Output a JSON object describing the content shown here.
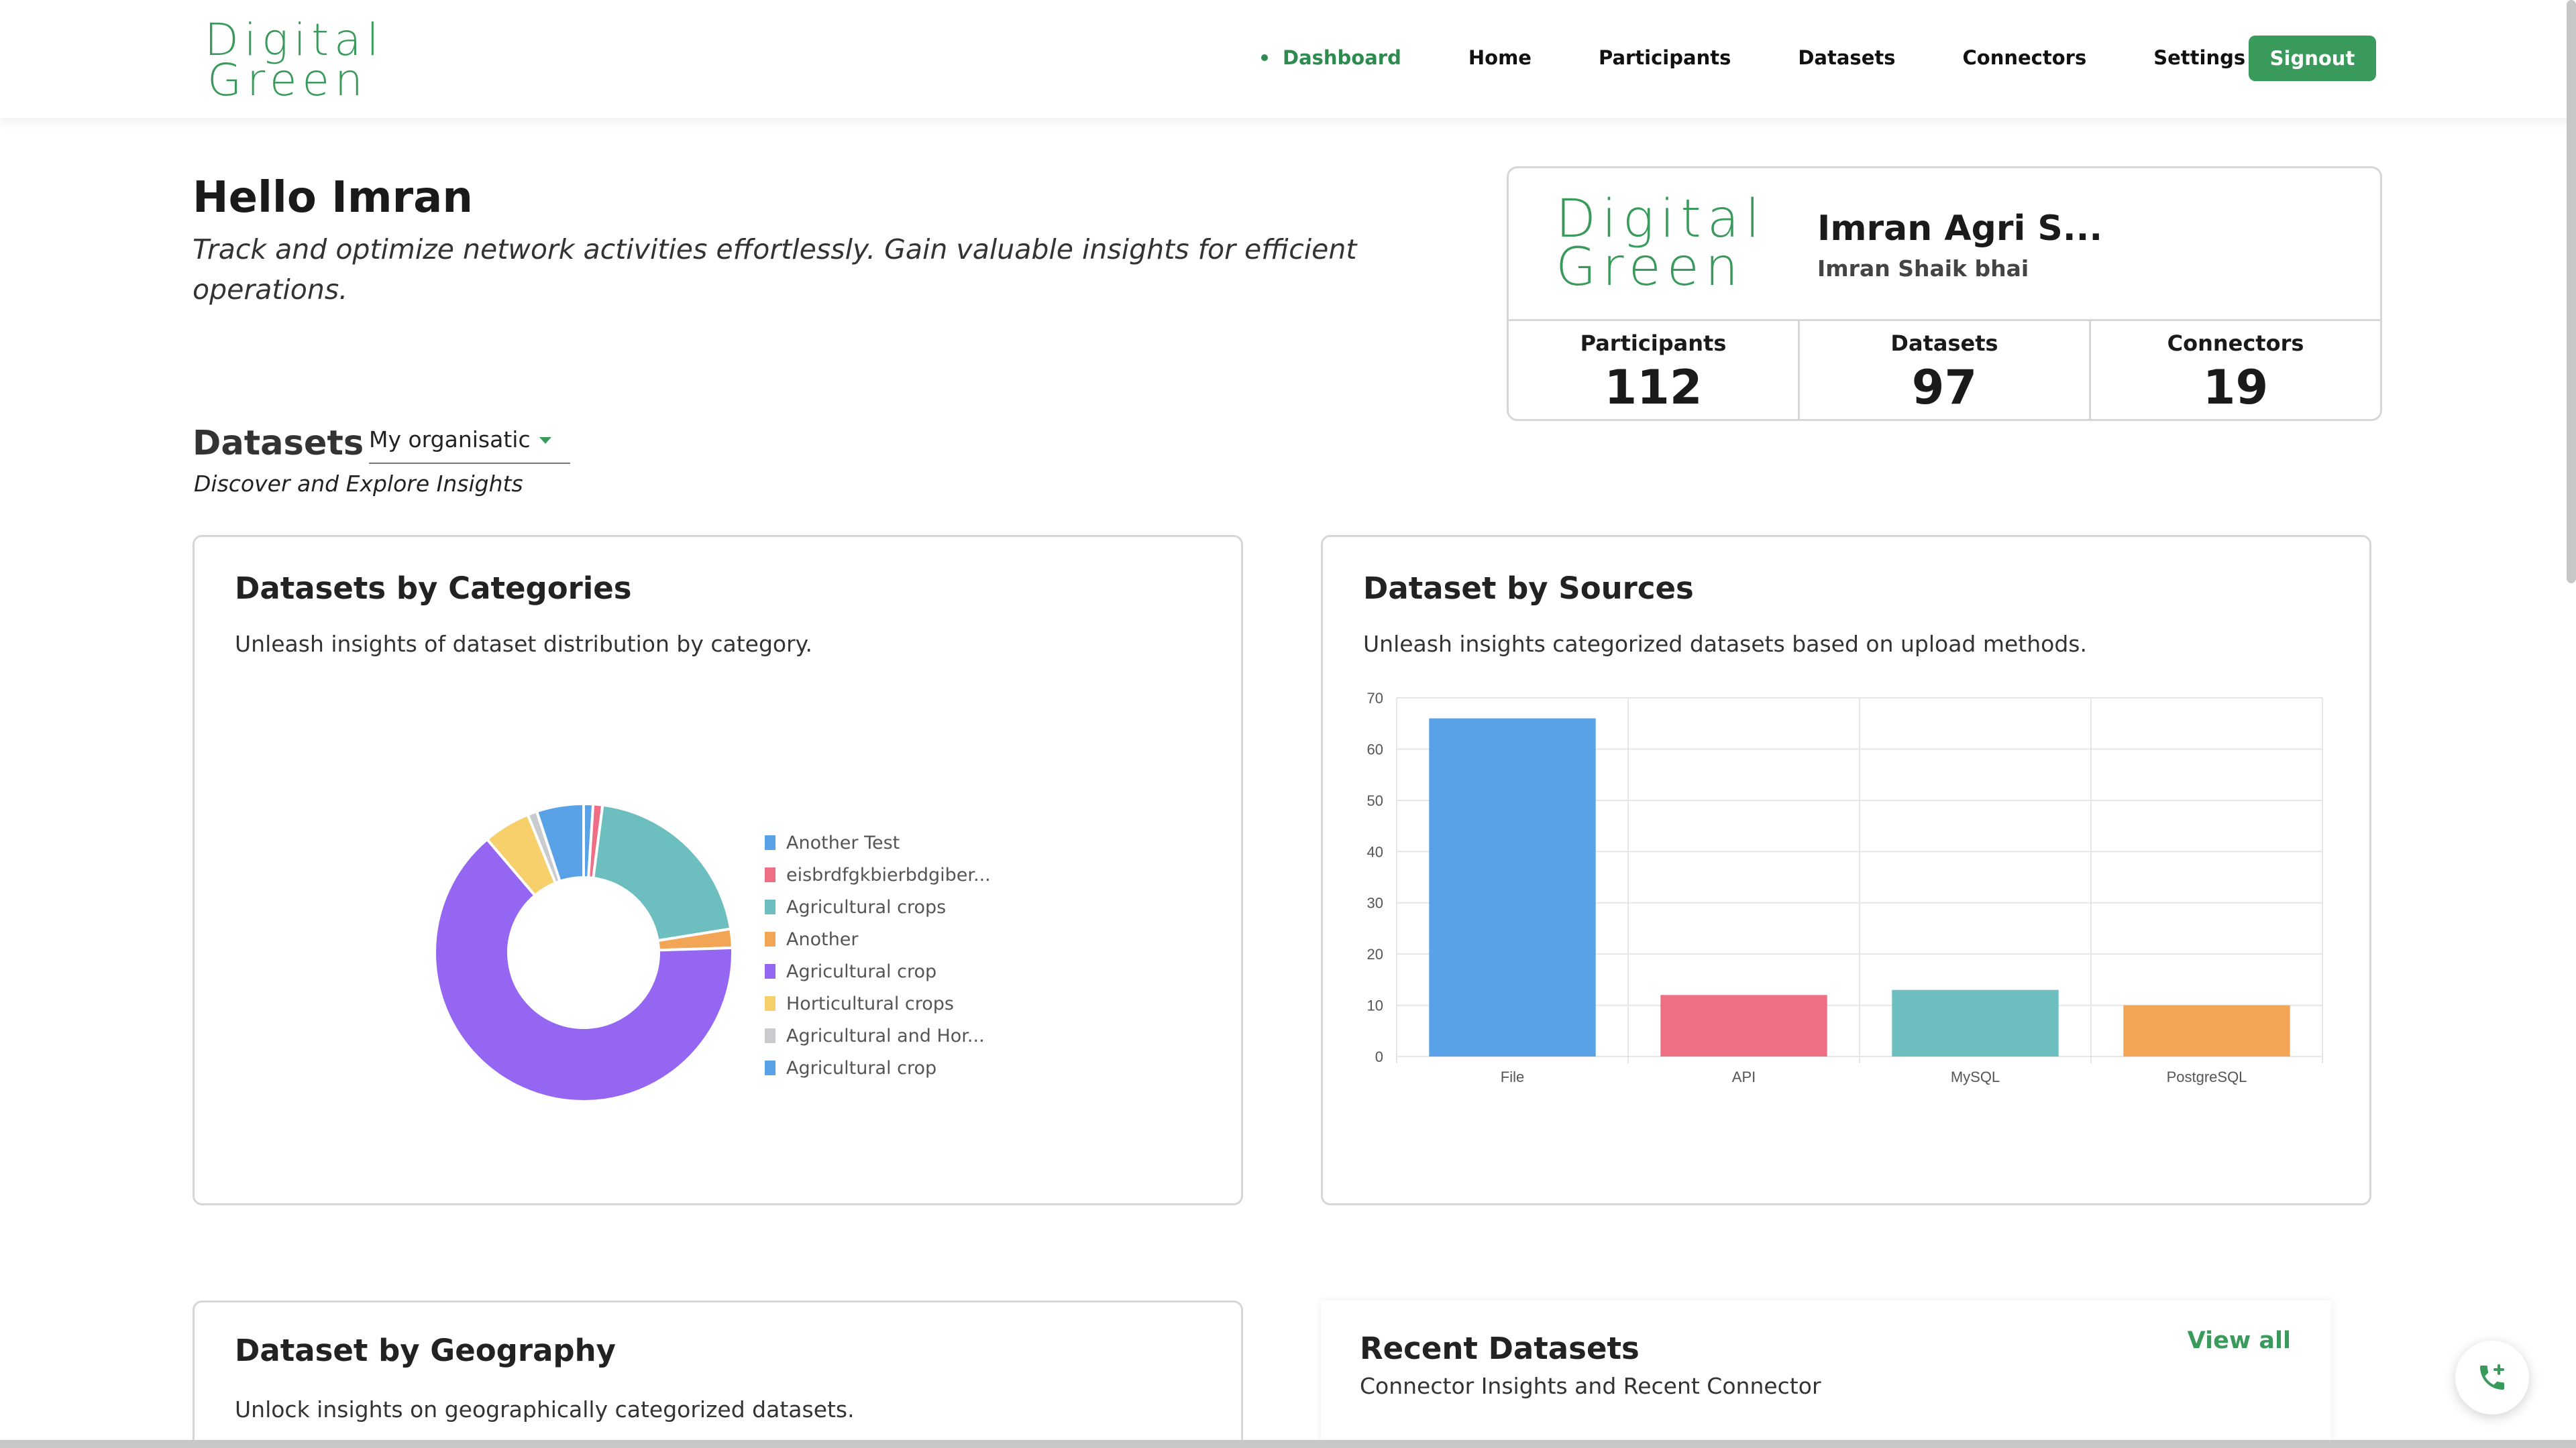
{
  "brand": {
    "logo_line1": "Digital",
    "logo_line2": "Green"
  },
  "nav": {
    "items": [
      {
        "label": "Dashboard",
        "active": true
      },
      {
        "label": "Home"
      },
      {
        "label": "Participants"
      },
      {
        "label": "Datasets"
      },
      {
        "label": "Connectors"
      },
      {
        "label": "Settings"
      }
    ],
    "signout": "Signout"
  },
  "greeting": {
    "title": "Hello Imran",
    "subtitle": "Track and optimize network activities effortlessly. Gain valuable insights for efficient operations."
  },
  "org_card": {
    "logo_line1": "Digital",
    "logo_line2": "Green",
    "name": "Imran Agri S...",
    "user": "Imran Shaik bhai",
    "stats": [
      {
        "label": "Participants",
        "value": "112"
      },
      {
        "label": "Datasets",
        "value": "97"
      },
      {
        "label": "Connectors",
        "value": "19"
      }
    ]
  },
  "datasets_section": {
    "title": "Datasets",
    "filter_value": "My organisatic",
    "subtitle": "Discover and Explore Insights"
  },
  "categories_card": {
    "title": "Datasets by Categories",
    "subtitle": "Unleash insights of dataset distribution by category."
  },
  "sources_card": {
    "title": "Dataset by Sources",
    "subtitle": "Unleash insights categorized datasets based on upload methods."
  },
  "geography_card": {
    "title": "Dataset by Geography",
    "subtitle": "Unlock insights on geographically categorized datasets."
  },
  "recent_card": {
    "title": "Recent Datasets",
    "subtitle": "Connector Insights and Recent Connector",
    "view_all": "View all"
  },
  "colors": {
    "brand_green": "#3a9a5b",
    "blue": "#5aa2e8",
    "pink": "#ee6e85",
    "teal": "#6dbfbf",
    "orange": "#f1a555",
    "purple": "#9466f2",
    "yellow": "#f7cf6b",
    "grey": "#c9cbcf"
  },
  "chart_data": [
    {
      "type": "pie",
      "donut": true,
      "legend_position": "right",
      "labels": [
        "Another Test",
        "eisbrdfgkbierbdgiber...",
        "Agricultural crops",
        "Another",
        "Agricultural crop",
        "Horticultural crops",
        "Agricultural and Hor...",
        "Agricultural crop"
      ],
      "values": [
        1,
        1,
        20,
        2,
        63,
        5,
        1,
        5
      ],
      "colors": [
        "#5aa2e8",
        "#ee6e85",
        "#6dbfbf",
        "#f1a555",
        "#9466f2",
        "#f7cf6b",
        "#c9cbcf",
        "#5aa2e8"
      ]
    },
    {
      "type": "bar",
      "categories": [
        "File",
        "API",
        "MySQL",
        "PostgreSQL"
      ],
      "values": [
        66,
        12,
        13,
        10
      ],
      "colors": [
        "#5aa2e8",
        "#ee6e85",
        "#6dbfbf",
        "#f1a555"
      ],
      "ylim": [
        0,
        70
      ],
      "yticks": [
        0,
        10,
        20,
        30,
        40,
        50,
        60,
        70
      ],
      "grid": true
    }
  ]
}
